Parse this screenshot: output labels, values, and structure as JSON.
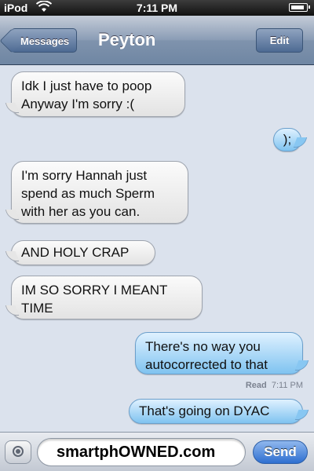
{
  "status_bar": {
    "carrier": "iPod",
    "time": "7:11 PM",
    "battery": 0.9
  },
  "nav": {
    "back_label": "Messages",
    "title": "Peyton",
    "edit_label": "Edit"
  },
  "messages": [
    {
      "side": "in",
      "text": "Idk I just have to poop\nAnyway I'm sorry :("
    },
    {
      "side": "out",
      "text": ");"
    },
    {
      "side": "in",
      "text": "I'm sorry Hannah just\nspend as much Sperm\nwith her as you can."
    },
    {
      "side": "in",
      "text": "AND HOLY CRAP"
    },
    {
      "side": "in",
      "text": "IM SO SORRY I MEANT\nTIME"
    },
    {
      "side": "out",
      "text": "There's no way you\nautocorrected to that"
    },
    {
      "side": "out",
      "text": "That's going on DYAC"
    }
  ],
  "receipt": {
    "label": "Read",
    "time": "7:11 PM"
  },
  "input_bar": {
    "watermark": "smartphOWNED.com",
    "send_label": "Send"
  }
}
